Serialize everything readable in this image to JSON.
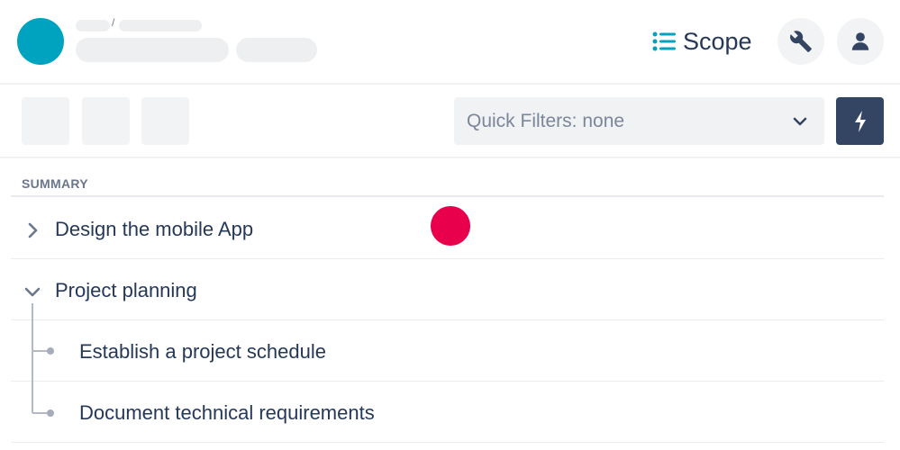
{
  "header": {
    "breadcrumb_separator": "/",
    "scope_tab": {
      "label": "Scope",
      "icon": "list-icon"
    },
    "settings_button": {
      "icon": "wrench-icon"
    },
    "user_button": {
      "icon": "user-icon"
    }
  },
  "toolbar": {
    "quick_filters": {
      "value": "Quick Filters: none",
      "icon": "chevron-down-icon"
    },
    "bolt_button": {
      "icon": "lightning-bolt-icon"
    }
  },
  "summary": {
    "header": "SUMMARY",
    "rows": [
      {
        "label": "Design the mobile App",
        "expanded": false
      },
      {
        "label": "Project planning",
        "expanded": true
      },
      {
        "label": "Establish a project schedule",
        "child": true
      },
      {
        "label": "Document technical requirements",
        "child": true
      }
    ]
  },
  "colors": {
    "project_avatar": "#00a3bf",
    "scope_icon": "#00a3bf",
    "bolt_button_bg": "#344563",
    "pointer_marker": "#e8004c"
  }
}
